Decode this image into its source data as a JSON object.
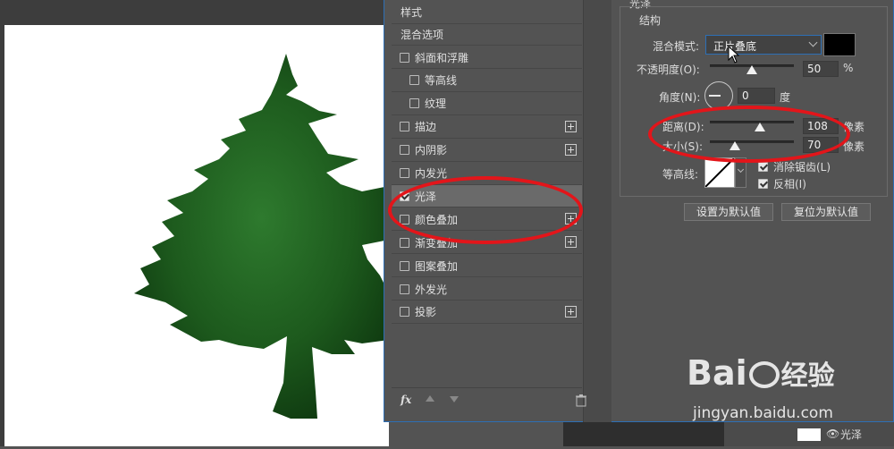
{
  "layer_list": {
    "header": "样式",
    "blend_options": "混合选项",
    "items": [
      {
        "label": "斜面和浮雕",
        "checked": false,
        "indent": false,
        "plus": false
      },
      {
        "label": "等高线",
        "checked": false,
        "indent": true,
        "plus": false
      },
      {
        "label": "纹理",
        "checked": false,
        "indent": true,
        "plus": false
      },
      {
        "label": "描边",
        "checked": false,
        "indent": false,
        "plus": true
      },
      {
        "label": "内阴影",
        "checked": false,
        "indent": false,
        "plus": true
      },
      {
        "label": "内发光",
        "checked": false,
        "indent": false,
        "plus": false
      },
      {
        "label": "光泽",
        "checked": true,
        "indent": false,
        "plus": false,
        "active": true
      },
      {
        "label": "颜色叠加",
        "checked": false,
        "indent": false,
        "plus": true
      },
      {
        "label": "渐变叠加",
        "checked": false,
        "indent": false,
        "plus": true
      },
      {
        "label": "图案叠加",
        "checked": false,
        "indent": false,
        "plus": false
      },
      {
        "label": "外发光",
        "checked": false,
        "indent": false,
        "plus": false
      },
      {
        "label": "投影",
        "checked": false,
        "indent": false,
        "plus": true
      }
    ],
    "footer": {
      "fx_label": "fx"
    }
  },
  "satin": {
    "section_title": "光泽",
    "group_title": "结构",
    "blend_mode_label": "混合模式:",
    "blend_mode_value": "正片叠底",
    "opacity_label": "不透明度(O):",
    "opacity_value": "50",
    "opacity_unit": "%",
    "opacity_fraction": 0.5,
    "angle_label": "角度(N):",
    "angle_value": "0",
    "angle_unit": "度",
    "distance_label": "距离(D):",
    "distance_value": "108",
    "distance_unit": "像素",
    "distance_fraction": 0.6,
    "size_label": "大小(S):",
    "size_value": "70",
    "size_unit": "像素",
    "size_fraction": 0.3,
    "contour_label": "等高线:",
    "antialias_label": "消除锯齿(L)",
    "antialias_checked": true,
    "invert_label": "反相(I)",
    "invert_checked": true,
    "set_default_button": "设置为默认值",
    "reset_default_button": "复位为默认值"
  },
  "statusbar": {
    "layer_name": "光泽"
  },
  "watermark": {
    "brand": "Bai",
    "brand_suffix": "经验",
    "url": "jingyan.baidu.com"
  },
  "colors": {
    "swatch": "#000000",
    "tree": "#1d5a1d",
    "annotation": "#e3151a"
  }
}
